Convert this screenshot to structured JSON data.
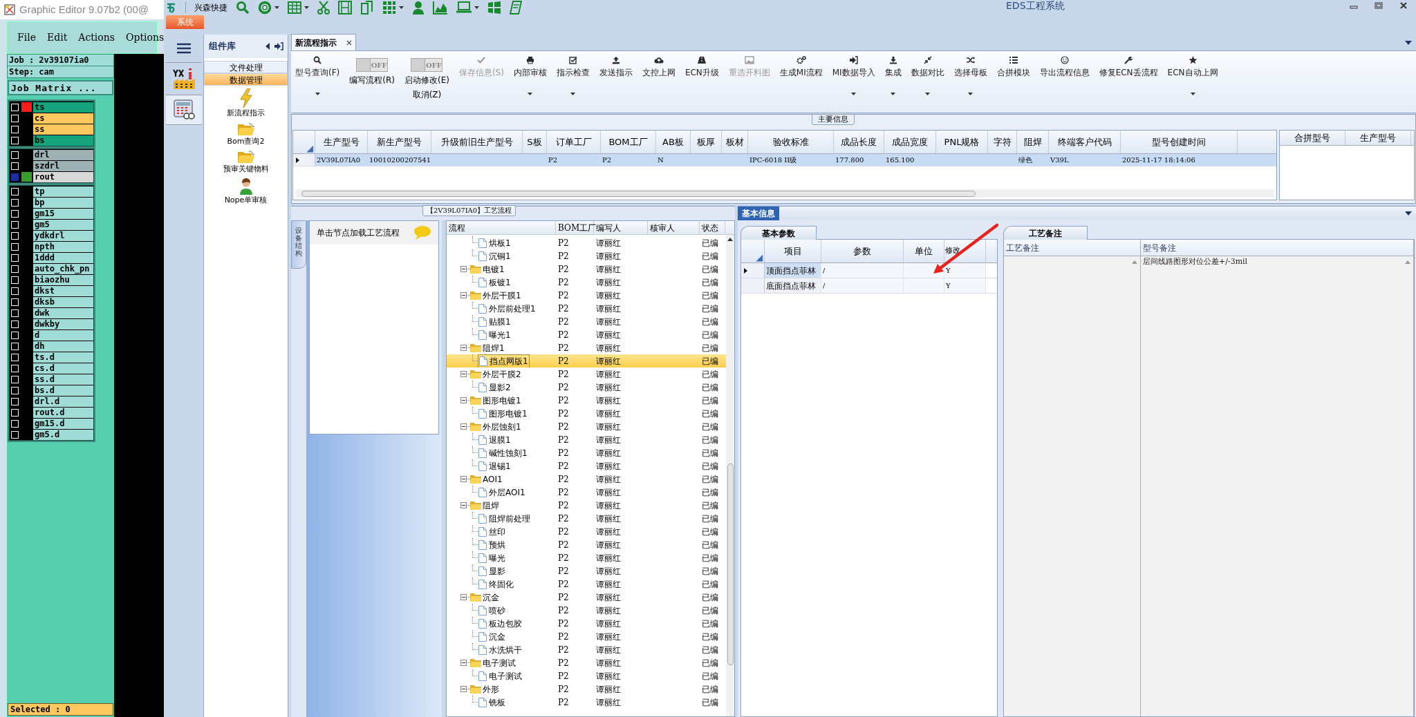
{
  "cad": {
    "title": "Graphic Editor 9.07b2 (00@",
    "menu": [
      "File",
      "Edit",
      "Actions",
      "Options"
    ],
    "job": "Job : 2v39107ia0",
    "step": "Step: cam",
    "matrix_button": "Job Matrix ...",
    "layer_groups": [
      [
        {
          "name": "ts",
          "color": "#14a37b",
          "swatch": {
            "color": "#ff1a1a"
          },
          "selected": false
        },
        {
          "name": "cs",
          "color": "#ffc85e",
          "selected": false
        },
        {
          "name": "ss",
          "color": "#ffc85e",
          "selected": false
        },
        {
          "name": "bs",
          "color": "#14a37b",
          "selected": false
        }
      ],
      [
        {
          "name": "drl",
          "color": "#9eb1b5",
          "selected": false
        },
        {
          "name": "szdrl",
          "color": "#9eb1b5",
          "selected": false
        },
        {
          "name": "rout",
          "color": "#d9d9d9",
          "swatch": {
            "color": "#37a02a"
          },
          "selected": true
        }
      ],
      [
        {
          "name": "tp",
          "color": "#9fdcd8",
          "selected": false
        },
        {
          "name": "bp",
          "color": "#9fdcd8",
          "selected": false
        },
        {
          "name": "gm15",
          "color": "#9fdcd8",
          "selected": false
        },
        {
          "name": "gm5",
          "color": "#9fdcd8",
          "selected": false
        },
        {
          "name": "ydkdrl",
          "color": "#9fdcd8",
          "selected": false
        },
        {
          "name": "npth",
          "color": "#9fdcd8",
          "selected": false
        },
        {
          "name": "1ddd",
          "color": "#9fdcd8",
          "selected": false
        },
        {
          "name": "auto_chk_pn",
          "color": "#9fdcd8",
          "selected": false
        },
        {
          "name": "biaozhu",
          "color": "#9fdcd8",
          "selected": false
        },
        {
          "name": "dkst",
          "color": "#9fdcd8",
          "selected": false
        },
        {
          "name": "dksb",
          "color": "#9fdcd8",
          "selected": false
        },
        {
          "name": "dwk",
          "color": "#9fdcd8",
          "selected": false
        },
        {
          "name": "dwkby",
          "color": "#9fdcd8",
          "selected": false
        },
        {
          "name": "d",
          "color": "#9fdcd8",
          "selected": false
        },
        {
          "name": "dh",
          "color": "#9fdcd8",
          "selected": false
        },
        {
          "name": "ts.d",
          "color": "#9fdcd8",
          "selected": false
        },
        {
          "name": "cs.d",
          "color": "#9fdcd8",
          "selected": false
        },
        {
          "name": "ss.d",
          "color": "#9fdcd8",
          "selected": false
        },
        {
          "name": "bs.d",
          "color": "#9fdcd8",
          "selected": false
        },
        {
          "name": "drl.d",
          "color": "#9fdcd8",
          "selected": false
        },
        {
          "name": "rout.d",
          "color": "#9fdcd8",
          "selected": false
        },
        {
          "name": "gm15.d",
          "color": "#9fdcd8",
          "selected": false
        },
        {
          "name": "gm5.d",
          "color": "#9fdcd8",
          "selected": false
        }
      ]
    ],
    "status": "Selected : 0"
  },
  "window": {
    "title": "EDS工程系统",
    "quick_label": "兴森快捷",
    "menu_tab": "系统"
  },
  "component_library": {
    "title": "组件库",
    "nav": [
      {
        "label": "文件处理",
        "selected": false
      },
      {
        "label": "数据管理",
        "selected": true
      }
    ],
    "tools": [
      "新流程指示",
      "Bom查询2",
      "预审关键物料",
      "Nope单审核"
    ]
  },
  "tabs": [
    {
      "label": "新流程指示",
      "selected": true
    }
  ],
  "toolbar": [
    {
      "kind": "button",
      "label": "型号查询(F)",
      "has_menu": true,
      "disabled": false
    },
    {
      "kind": "toggle",
      "state_text": "OFF",
      "on": false,
      "label": "编写流程(R)"
    },
    {
      "kind": "toggle",
      "state_text": "OFF",
      "on": false,
      "label": "启动修改(E)",
      "sublabel": "取消(Z)"
    },
    {
      "kind": "button",
      "label": "保存信息(S)",
      "has_menu": false,
      "disabled": true
    },
    {
      "kind": "button",
      "label": "内部审核",
      "has_menu": true,
      "disabled": false
    },
    {
      "kind": "button",
      "label": "指示检查",
      "has_menu": true,
      "disabled": false
    },
    {
      "kind": "button",
      "label": "发送指示",
      "has_menu": false,
      "disabled": false
    },
    {
      "kind": "button",
      "label": "文控上网",
      "has_menu": false,
      "disabled": false
    },
    {
      "kind": "button",
      "label": "ECN升级",
      "has_menu": false,
      "disabled": false
    },
    {
      "kind": "button",
      "label": "重选开料图",
      "has_menu": false,
      "disabled": true
    },
    {
      "kind": "button",
      "label": "生成MI流程",
      "has_menu": false,
      "disabled": false
    },
    {
      "kind": "button",
      "label": "MI数据导入",
      "has_menu": true,
      "disabled": false
    },
    {
      "kind": "button",
      "label": "集成",
      "has_menu": true,
      "disabled": false
    },
    {
      "kind": "button",
      "label": "数据对比",
      "has_menu": true,
      "disabled": false
    },
    {
      "kind": "button",
      "label": "选择母板",
      "has_menu": true,
      "disabled": false
    },
    {
      "kind": "button",
      "label": "合拼模块",
      "has_menu": false,
      "disabled": false
    },
    {
      "kind": "button",
      "label": "导出流程信息",
      "has_menu": false,
      "disabled": false
    },
    {
      "kind": "button",
      "label": "修复ECN丢流程",
      "has_menu": false,
      "disabled": false
    },
    {
      "kind": "button",
      "label": "ECN自动上网",
      "has_menu": true,
      "disabled": false
    }
  ],
  "main_info": {
    "title": "主要信息",
    "columns": [
      "生产型号",
      "新生产型号",
      "升级前旧生产型号",
      "S板",
      "订单工厂",
      "BOM工厂",
      "AB板",
      "板厚",
      "板材",
      "验收标准",
      "成品长度",
      "成品宽度",
      "PNL规格",
      "字符",
      "阻焊",
      "终端客户代码",
      "型号创建时间"
    ],
    "rows": [
      {
        "selected": true,
        "cells": [
          "2V39L07IA0",
          "10010200207541",
          null,
          null,
          "P2",
          "P2",
          "N",
          null,
          null,
          "IPC-6018 II级",
          "177.800",
          "165.100",
          null,
          null,
          "绿色",
          "V39L",
          "2025-11-17 18:14:06"
        ]
      }
    ],
    "side_columns": [
      "合拼型号",
      "生产型号"
    ]
  },
  "process": {
    "title": "【2V39L07IA0】工艺流程",
    "side_tab": "设备结构",
    "hint": "单击节点加载工艺流程",
    "columns": [
      "流程",
      "BOM工厂",
      "编写人",
      "核审人",
      "状态"
    ],
    "nodes": [
      {
        "children": [
          {
            "name": "烘板1",
            "bom": "P2",
            "author": "谭丽红",
            "status": "已编",
            "selected": false
          },
          {
            "name": "沉铜1",
            "bom": "P2",
            "author": "谭丽红",
            "status": "已编",
            "selected": false
          }
        ]
      },
      {
        "name": "电镀1",
        "bom": "P2",
        "author": "谭丽红",
        "status": "已编",
        "selected": false,
        "expanded": true,
        "children": [
          {
            "name": "板镀1",
            "bom": "P2",
            "author": "谭丽红",
            "status": "已编",
            "selected": false
          }
        ]
      },
      {
        "name": "外层干膜1",
        "bom": "P2",
        "author": "谭丽红",
        "status": "已编",
        "selected": false,
        "expanded": true,
        "children": [
          {
            "name": "外层前处理1",
            "bom": "P2",
            "author": "谭丽红",
            "status": "已编",
            "selected": false
          },
          {
            "name": "贴膜1",
            "bom": "P2",
            "author": "谭丽红",
            "status": "已编",
            "selected": false
          },
          {
            "name": "曝光1",
            "bom": "P2",
            "author": "谭丽红",
            "status": "已编",
            "selected": false
          }
        ]
      },
      {
        "name": "阻焊1",
        "bom": "P2",
        "author": "谭丽红",
        "status": "已编",
        "selected": false,
        "expanded": true,
        "children": [
          {
            "name": "挡点网版1",
            "bom": "P2",
            "author": "谭丽红",
            "status": "已编",
            "selected": true
          }
        ]
      },
      {
        "name": "外层干膜2",
        "bom": "P2",
        "author": "谭丽红",
        "status": "已编",
        "selected": false,
        "expanded": true,
        "children": [
          {
            "name": "显影2",
            "bom": "P2",
            "author": "谭丽红",
            "status": "已编",
            "selected": false
          }
        ]
      },
      {
        "name": "图形电镀1",
        "bom": "P2",
        "author": "谭丽红",
        "status": "已编",
        "selected": false,
        "expanded": true,
        "children": [
          {
            "name": "图形电镀1",
            "bom": "P2",
            "author": "谭丽红",
            "status": "已编",
            "selected": false
          }
        ]
      },
      {
        "name": "外层蚀刻1",
        "bom": "P2",
        "author": "谭丽红",
        "status": "已编",
        "selected": false,
        "expanded": true,
        "children": [
          {
            "name": "退膜1",
            "bom": "P2",
            "author": "谭丽红",
            "status": "已编",
            "selected": false
          },
          {
            "name": "碱性蚀刻1",
            "bom": "P2",
            "author": "谭丽红",
            "status": "已编",
            "selected": false
          },
          {
            "name": "退锡1",
            "bom": "P2",
            "author": "谭丽红",
            "status": "已编",
            "selected": false
          }
        ]
      },
      {
        "name": "AOI1",
        "bom": "P2",
        "author": "谭丽红",
        "status": "已编",
        "selected": false,
        "expanded": true,
        "children": [
          {
            "name": "外层AOI1",
            "bom": "P2",
            "author": "谭丽红",
            "status": "已编",
            "selected": false
          }
        ]
      },
      {
        "name": "阻焊",
        "bom": "P2",
        "author": "谭丽红",
        "status": "已编",
        "selected": false,
        "expanded": true,
        "children": [
          {
            "name": "阻焊前处理",
            "bom": "P2",
            "author": "谭丽红",
            "status": "已编",
            "selected": false
          },
          {
            "name": "丝印",
            "bom": "P2",
            "author": "谭丽红",
            "status": "已编",
            "selected": false
          },
          {
            "name": "预烘",
            "bom": "P2",
            "author": "谭丽红",
            "status": "已编",
            "selected": false
          },
          {
            "name": "曝光",
            "bom": "P2",
            "author": "谭丽红",
            "status": "已编",
            "selected": false
          },
          {
            "name": "显影",
            "bom": "P2",
            "author": "谭丽红",
            "status": "已编",
            "selected": false
          },
          {
            "name": "终固化",
            "bom": "P2",
            "author": "谭丽红",
            "status": "已编",
            "selected": false
          }
        ]
      },
      {
        "name": "沉金",
        "bom": "P2",
        "author": "谭丽红",
        "status": "已编",
        "selected": false,
        "expanded": true,
        "children": [
          {
            "name": "喷砂",
            "bom": "P2",
            "author": "谭丽红",
            "status": "已编",
            "selected": false
          },
          {
            "name": "板边包胶",
            "bom": "P2",
            "author": "谭丽红",
            "status": "已编",
            "selected": false
          },
          {
            "name": "沉金",
            "bom": "P2",
            "author": "谭丽红",
            "status": "已编",
            "selected": false
          },
          {
            "name": "水洗烘干",
            "bom": "P2",
            "author": "谭丽红",
            "status": "已编",
            "selected": false
          }
        ]
      },
      {
        "name": "电子测试",
        "bom": "P2",
        "author": "谭丽红",
        "status": "已编",
        "selected": false,
        "expanded": true,
        "children": [
          {
            "name": "电子测试",
            "bom": "P2",
            "author": "谭丽红",
            "status": "已编",
            "selected": false
          }
        ]
      },
      {
        "name": "外形",
        "bom": "P2",
        "author": "谭丽红",
        "status": "已编",
        "selected": false,
        "expanded": true,
        "children": [
          {
            "name": "铣板",
            "bom": "P2",
            "author": "谭丽红",
            "status": "已编",
            "selected": false
          }
        ]
      }
    ]
  },
  "basic_info": {
    "title": "基本信息",
    "params_tab": "基本参数",
    "params_columns": [
      "项目",
      "参数",
      "单位",
      "修改"
    ],
    "params_rows": [
      {
        "selected": true,
        "cells": [
          "顶面挡点菲林",
          "/",
          null,
          "Y"
        ]
      },
      {
        "selected": false,
        "cells": [
          "底面挡点菲林",
          "/",
          null,
          "Y"
        ]
      }
    ],
    "notes_tab": "工艺备注",
    "notes_columns": [
      "工艺备注",
      "型号备注"
    ],
    "notes_rows": [
      {
        "cells": [
          null,
          "层间线路图形对位公差+/-3mil"
        ]
      }
    ]
  }
}
